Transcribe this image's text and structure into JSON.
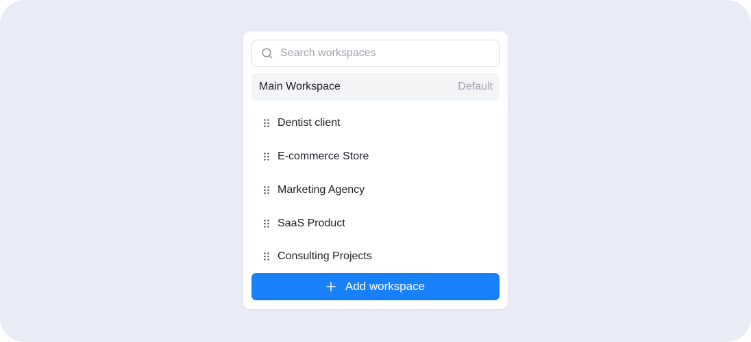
{
  "search": {
    "placeholder": "Search workspaces",
    "icon": "search-icon"
  },
  "default_workspace": {
    "name": "Main Workspace",
    "badge": "Default"
  },
  "workspaces": [
    {
      "label": "Dentist client"
    },
    {
      "label": "E-commerce Store"
    },
    {
      "label": "Marketing Agency"
    },
    {
      "label": "SaaS Product"
    },
    {
      "label": "Consulting Projects"
    }
  ],
  "add_button": {
    "label": "Add workspace",
    "icon": "plus-icon"
  },
  "colors": {
    "background": "#e9ebf6",
    "accent": "#1881f9",
    "default_row": "#f3f4f6",
    "muted_text": "#9ea2ab"
  }
}
